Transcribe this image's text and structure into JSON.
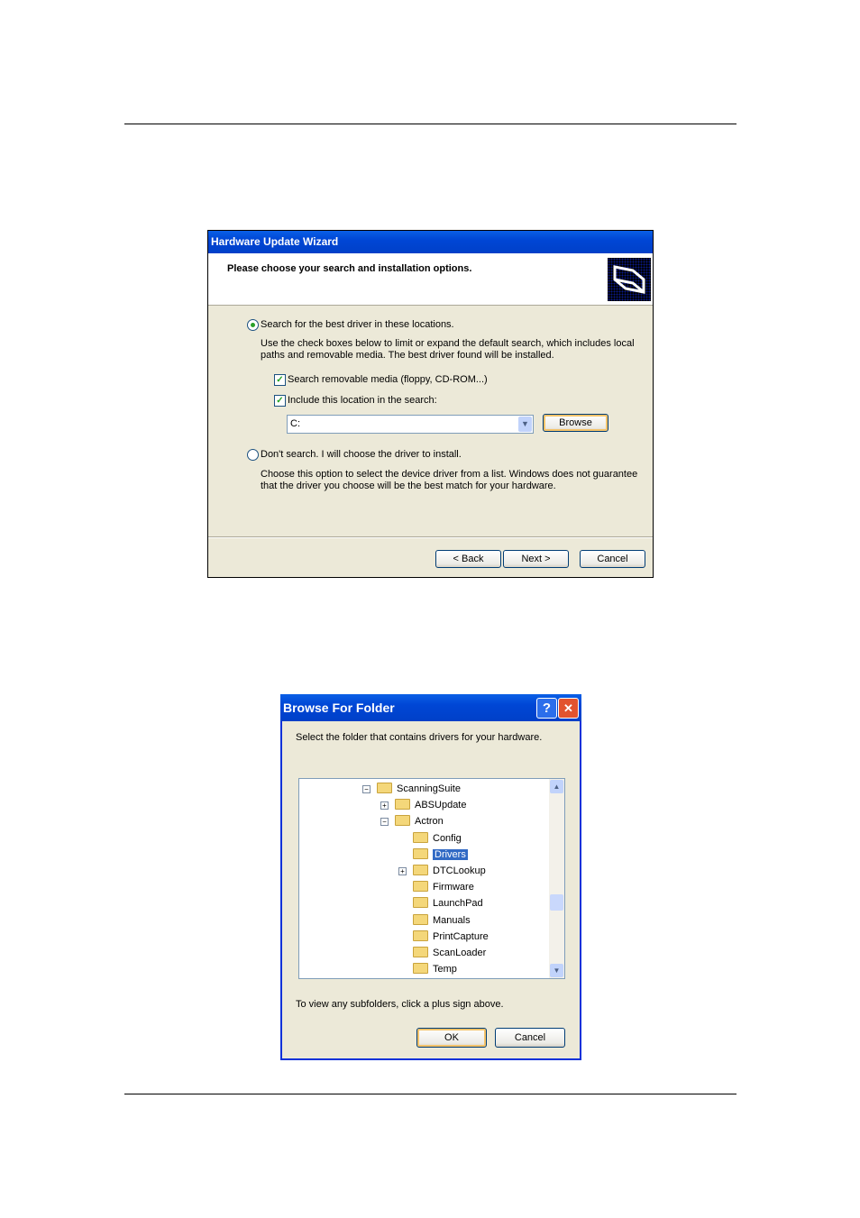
{
  "wizard": {
    "title": "Hardware Update Wizard",
    "heading": "Please choose your search and installation options.",
    "icon": "hardware-icon",
    "option_search": {
      "label": "Search for the best driver in these locations.",
      "selected": true,
      "description": "Use the check boxes below to limit or expand the default search, which includes local paths and removable media. The best driver found will be installed."
    },
    "check_removable": {
      "label": "Search removable media (floppy, CD-ROM...)",
      "checked": true
    },
    "check_location": {
      "label": "Include this location in the search:",
      "checked": true
    },
    "location_value": "C:",
    "browse_label": "Browse",
    "option_manual": {
      "label": "Don't search. I will choose the driver to install.",
      "selected": false,
      "description": "Choose this option to select the device driver from a list.  Windows does not guarantee that the driver you choose will be the best match for your hardware."
    },
    "back_label": "< Back",
    "next_label": "Next >",
    "cancel_label": "Cancel"
  },
  "browse": {
    "title": "Browse For Folder",
    "instruction": "Select the folder that contains drivers for your hardware.",
    "tree": [
      {
        "label": "ScanningSuite",
        "level": 0,
        "expander": "-"
      },
      {
        "label": "ABSUpdate",
        "level": 1,
        "expander": "+"
      },
      {
        "label": "Actron",
        "level": 1,
        "expander": "-"
      },
      {
        "label": "Config",
        "level": 2,
        "expander": ""
      },
      {
        "label": "Drivers",
        "level": 2,
        "expander": "",
        "selected": true
      },
      {
        "label": "DTCLookup",
        "level": 2,
        "expander": "+"
      },
      {
        "label": "Firmware",
        "level": 2,
        "expander": ""
      },
      {
        "label": "LaunchPad",
        "level": 2,
        "expander": ""
      },
      {
        "label": "Manuals",
        "level": 2,
        "expander": ""
      },
      {
        "label": "PrintCapture",
        "level": 2,
        "expander": ""
      },
      {
        "label": "ScanLoader",
        "level": 2,
        "expander": ""
      },
      {
        "label": "Temp",
        "level": 2,
        "expander": ""
      }
    ],
    "hint": "To view any subfolders, click a plus sign above.",
    "ok_label": "OK",
    "cancel_label": "Cancel",
    "help_label": "?",
    "close_label": "✕"
  }
}
